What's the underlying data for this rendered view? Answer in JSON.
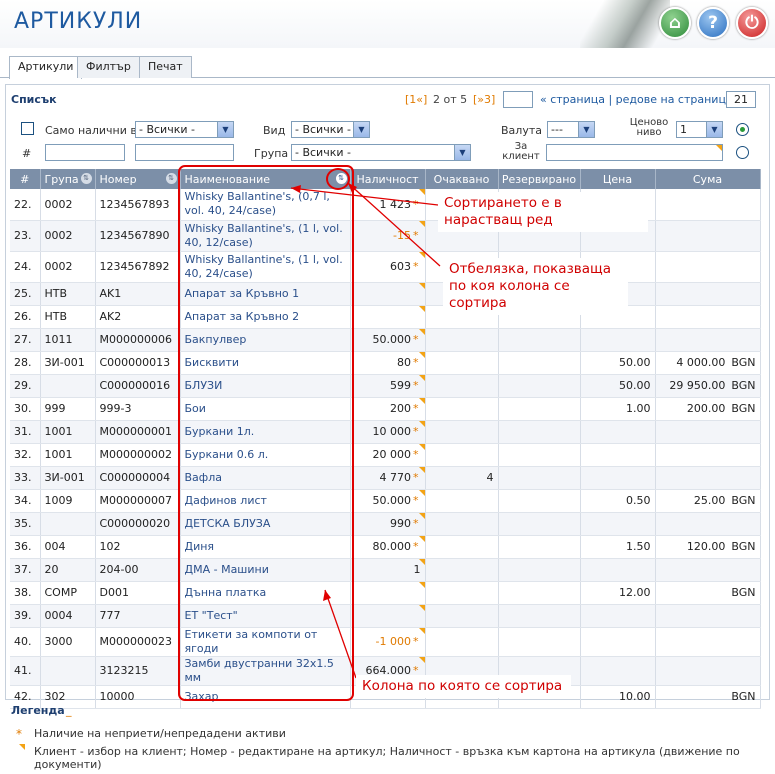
{
  "app": {
    "title": "АРТИКУЛИ"
  },
  "header_buttons": [
    {
      "name": "home-button",
      "icon": "home-icon",
      "glyph": "⌂"
    },
    {
      "name": "help-button",
      "icon": "help-icon",
      "glyph": "?"
    },
    {
      "name": "exit-button",
      "icon": "power-icon",
      "glyph": "⏻"
    }
  ],
  "tabs": [
    {
      "label": "Артикули",
      "active": true
    },
    {
      "label": "Филтър",
      "active": false
    },
    {
      "label": "Печат",
      "active": false
    }
  ],
  "list": {
    "title": "Списък"
  },
  "pager": {
    "first": "[1«]",
    "position": "2 от 5",
    "last": "[»3]",
    "page_input": "",
    "label": "« страница | редове на страница »",
    "rows_per_page": "21"
  },
  "filters": {
    "only_available_label": "Само налични в",
    "warehouse_select": "- Всички -",
    "type_label": "Вид",
    "type_select": "- Всички -",
    "currency_label": "Валута",
    "currency_select": "---",
    "price_level_label": "Ценово ниво",
    "price_level_select": "1",
    "hash_label": "#",
    "group_label": "Група",
    "group_select": "- Всички -",
    "client_label": "За клиент"
  },
  "table": {
    "columns": [
      "#",
      "Група",
      "Номер",
      "Наименование",
      "Наличност",
      "Очаквано",
      "Резервирано",
      "Цена",
      "Сума"
    ],
    "rows": [
      {
        "n": "22.",
        "group": "0002",
        "code": "1234567893",
        "name": "Whisky Ballantine's, (0,7 l, vol. 40, 24/case)",
        "qty": "1 423",
        "star": true,
        "neg": false,
        "exp": "",
        "res": "",
        "price": "",
        "sum": "",
        "cur": ""
      },
      {
        "n": "23.",
        "group": "0002",
        "code": "1234567890",
        "name": "Whisky Ballantine's, (1 l, vol. 40, 12/case)",
        "qty": "-15",
        "star": true,
        "neg": true,
        "exp": "",
        "res": "",
        "price": "",
        "sum": "",
        "cur": ""
      },
      {
        "n": "24.",
        "group": "0002",
        "code": "1234567892",
        "name": "Whisky Ballantine's, (1 l, vol. 40, 24/case)",
        "qty": "603",
        "star": true,
        "neg": false,
        "exp": "",
        "res": "",
        "price": "",
        "sum": "",
        "cur": ""
      },
      {
        "n": "25.",
        "group": "НТВ",
        "code": "AK1",
        "name": "Апарат за Кръвно 1",
        "qty": "",
        "star": false,
        "neg": false,
        "exp": "",
        "res": "",
        "price": "",
        "sum": "",
        "cur": ""
      },
      {
        "n": "26.",
        "group": "НТВ",
        "code": "AK2",
        "name": "Апарат за Кръвно 2",
        "qty": "",
        "star": false,
        "neg": false,
        "exp": "",
        "res": "",
        "price": "",
        "sum": "",
        "cur": ""
      },
      {
        "n": "27.",
        "group": "1011",
        "code": "M000000006",
        "name": "Бакпулвер",
        "qty": "50.000",
        "star": true,
        "neg": false,
        "exp": "",
        "res": "",
        "price": "",
        "sum": "",
        "cur": ""
      },
      {
        "n": "28.",
        "group": "ЗИ-001",
        "code": "C000000013",
        "name": "Бисквити",
        "qty": "80",
        "star": true,
        "neg": false,
        "exp": "",
        "res": "",
        "price": "50.00",
        "sum": "4 000.00",
        "cur": "BGN"
      },
      {
        "n": "29.",
        "group": "",
        "code": "C000000016",
        "name": "БЛУЗИ",
        "qty": "599",
        "star": true,
        "neg": false,
        "exp": "",
        "res": "",
        "price": "50.00",
        "sum": "29 950.00",
        "cur": "BGN"
      },
      {
        "n": "30.",
        "group": "999",
        "code": "999-3",
        "name": "Бои",
        "qty": "200",
        "star": true,
        "neg": false,
        "exp": "",
        "res": "",
        "price": "1.00",
        "sum": "200.00",
        "cur": "BGN"
      },
      {
        "n": "31.",
        "group": "1001",
        "code": "M000000001",
        "name": "Буркани 1л.",
        "qty": "10 000",
        "star": true,
        "neg": false,
        "exp": "",
        "res": "",
        "price": "",
        "sum": "",
        "cur": ""
      },
      {
        "n": "32.",
        "group": "1001",
        "code": "M000000002",
        "name": "Буркани 0.6 л.",
        "qty": "20 000",
        "star": true,
        "neg": false,
        "exp": "",
        "res": "",
        "price": "",
        "sum": "",
        "cur": ""
      },
      {
        "n": "33.",
        "group": "ЗИ-001",
        "code": "C000000004",
        "name": "Вафла",
        "qty": "4 770",
        "star": true,
        "neg": false,
        "exp": "4",
        "res": "",
        "price": "",
        "sum": "",
        "cur": ""
      },
      {
        "n": "34.",
        "group": "1009",
        "code": "M000000007",
        "name": "Дафинов лист",
        "qty": "50.000",
        "star": true,
        "neg": false,
        "exp": "",
        "res": "",
        "price": "0.50",
        "sum": "25.00",
        "cur": "BGN"
      },
      {
        "n": "35.",
        "group": "",
        "code": "C000000020",
        "name": "ДЕТСКА БЛУЗА",
        "qty": "990",
        "star": true,
        "neg": false,
        "exp": "",
        "res": "",
        "price": "",
        "sum": "",
        "cur": ""
      },
      {
        "n": "36.",
        "group": "004",
        "code": "102",
        "name": "Диня",
        "qty": "80.000",
        "star": true,
        "neg": false,
        "exp": "",
        "res": "",
        "price": "1.50",
        "sum": "120.00",
        "cur": "BGN"
      },
      {
        "n": "37.",
        "group": "20",
        "code": "204-00",
        "name": "ДМА - Машини",
        "qty": "1",
        "star": false,
        "neg": false,
        "exp": "",
        "res": "",
        "price": "",
        "sum": "",
        "cur": ""
      },
      {
        "n": "38.",
        "group": "COMP",
        "code": "D001",
        "name": "Дънна платка",
        "qty": "",
        "star": false,
        "neg": false,
        "exp": "",
        "res": "",
        "price": "12.00",
        "sum": "",
        "cur": "BGN"
      },
      {
        "n": "39.",
        "group": "0004",
        "code": "777",
        "name": "ЕТ \"Тест\"",
        "qty": "",
        "star": false,
        "neg": false,
        "exp": "",
        "res": "",
        "price": "",
        "sum": "",
        "cur": ""
      },
      {
        "n": "40.",
        "group": "3000",
        "code": "M000000023",
        "name": "Етикети за компоти от ягоди",
        "qty": "-1 000",
        "star": true,
        "neg": true,
        "exp": "",
        "res": "",
        "price": "",
        "sum": "",
        "cur": ""
      },
      {
        "n": "41.",
        "group": "",
        "code": "3123215",
        "name": "Замби двустранни 32x1.5 мм",
        "qty": "664.000",
        "star": true,
        "neg": false,
        "exp": "",
        "res": "",
        "price": "",
        "sum": "",
        "cur": ""
      },
      {
        "n": "42.",
        "group": "302",
        "code": "10000",
        "name": "Захар",
        "qty": "",
        "star": false,
        "neg": false,
        "exp": "",
        "res": "",
        "price": "10.00",
        "sum": "",
        "cur": "BGN"
      }
    ]
  },
  "annotations": {
    "sort_ascending": "Сортирането е в нарастващ ред",
    "sort_marker": "Отбелязка, показваща по коя колона се сортира",
    "sort_column": "Колона по която се сортира"
  },
  "legend": {
    "title": "Легенда",
    "toggle": "_",
    "star_symbol": "*",
    "item1": "Наличие на неприети/непредадени активи",
    "item2": "Клиент - избор на клиент; Номер - редактиране на артикул; Наличност - връзка към картона на артикула (движение по документи)"
  },
  "colors": {
    "accent": "#1e5aa0",
    "header_row": "#7c8fa8",
    "warning": "#e07a00",
    "annotation": "#e00000"
  }
}
